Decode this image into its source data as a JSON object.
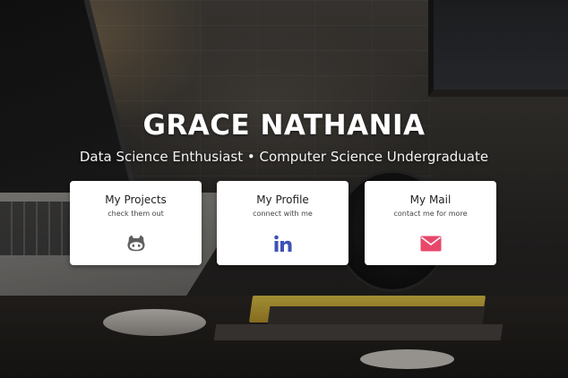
{
  "hero": {
    "name": "GRACE NATHANIA",
    "tagline": "Data Science Enthusiast • Computer Science Undergraduate"
  },
  "cards": [
    {
      "title": "My Projects",
      "subtitle": "check them out",
      "icon": "github-icon",
      "icon_color": "#5f5f5f"
    },
    {
      "title": "My Profile",
      "subtitle": "connect with me",
      "icon": "linkedin-icon",
      "icon_color": "#3f51b5"
    },
    {
      "title": "My Mail",
      "subtitle": "contact me for more",
      "icon": "mail-icon",
      "icon_color": "#e8476a"
    }
  ],
  "colors": {
    "card_background": "#ffffff",
    "heading_text": "#ffffff"
  }
}
